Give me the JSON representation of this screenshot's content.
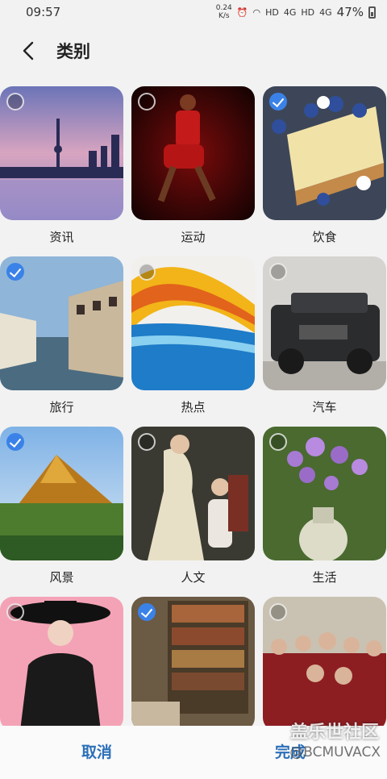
{
  "status": {
    "time": "09:57",
    "speed_top": "0.24",
    "speed_unit": "K/s",
    "net1": "HD",
    "net2": "4G",
    "net3": "HD",
    "net4": "4G",
    "battery": "47%"
  },
  "header": {
    "title": "类别"
  },
  "categories": [
    {
      "label": "资讯",
      "checked": false
    },
    {
      "label": "运动",
      "checked": false
    },
    {
      "label": "饮食",
      "checked": true
    },
    {
      "label": "旅行",
      "checked": true
    },
    {
      "label": "热点",
      "checked": false
    },
    {
      "label": "汽车",
      "checked": false
    },
    {
      "label": "风景",
      "checked": true
    },
    {
      "label": "人文",
      "checked": false
    },
    {
      "label": "生活",
      "checked": false
    },
    {
      "label": "",
      "checked": false
    },
    {
      "label": "",
      "checked": true
    },
    {
      "label": "",
      "checked": false
    }
  ],
  "footer": {
    "cancel": "取消",
    "done": "完成"
  },
  "watermark": {
    "line1": "盖乐世社区",
    "line2": "@BCMUVACX"
  },
  "colors": {
    "accent": "#3b82e8",
    "button_text": "#2b6fb8"
  }
}
